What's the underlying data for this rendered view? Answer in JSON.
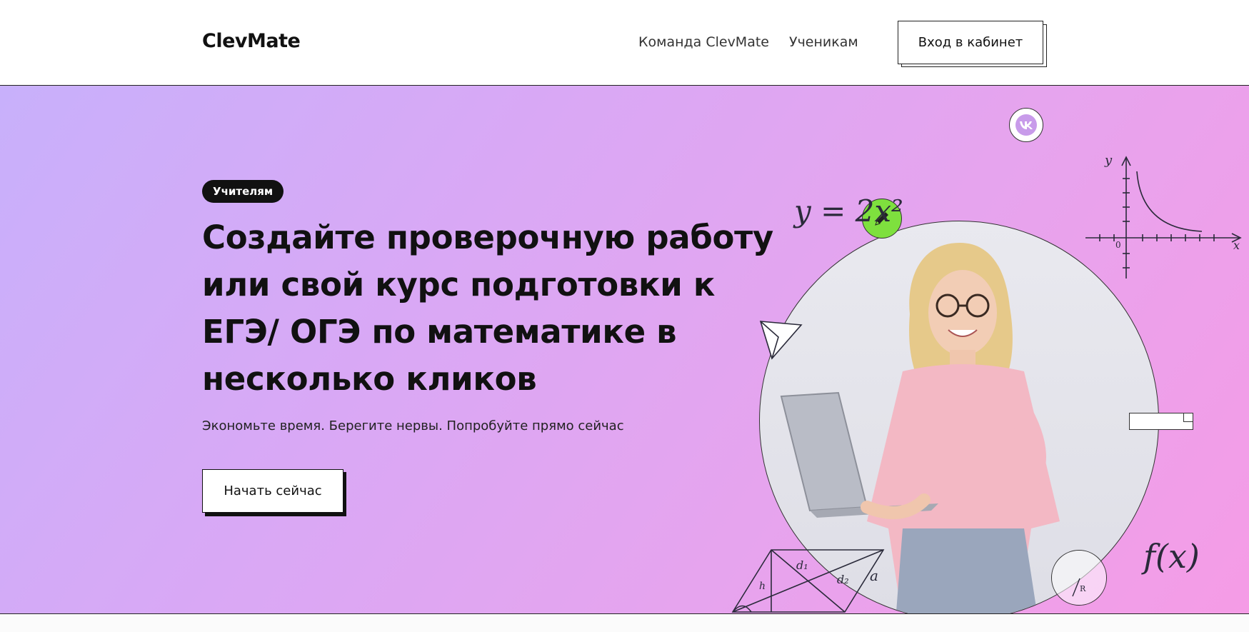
{
  "header": {
    "logo": "ClevMate",
    "nav": [
      {
        "label": "Команда ClevMate"
      },
      {
        "label": "Ученикам"
      }
    ],
    "login_label": "Вход в кабинет"
  },
  "hero": {
    "badge": "Учителям",
    "title": "Создайте проверочную работу или свой курс подготовки к ЕГЭ/ ОГЭ по математике в несколько кликов",
    "subtitle": "Экономьте время. Берегите нервы. Попробуйте прямо сейчас",
    "cta_label": "Начать сейчас"
  },
  "illustration": {
    "formula": "y = 2x²",
    "function_label": "f(x)",
    "graph_axis_y": "y",
    "graph_axis_x": "x",
    "graph_origin": "0",
    "geometry_labels": [
      "h",
      "d₁",
      "d₂",
      "a"
    ],
    "small_circle_label": "R",
    "icons": [
      "vk-icon",
      "pencil-icon",
      "paper-plane-icon"
    ],
    "colors": {
      "pencil_badge": "#7ee03e",
      "gradient_start": "#c8b0fb",
      "gradient_end": "#f59ce6"
    }
  }
}
